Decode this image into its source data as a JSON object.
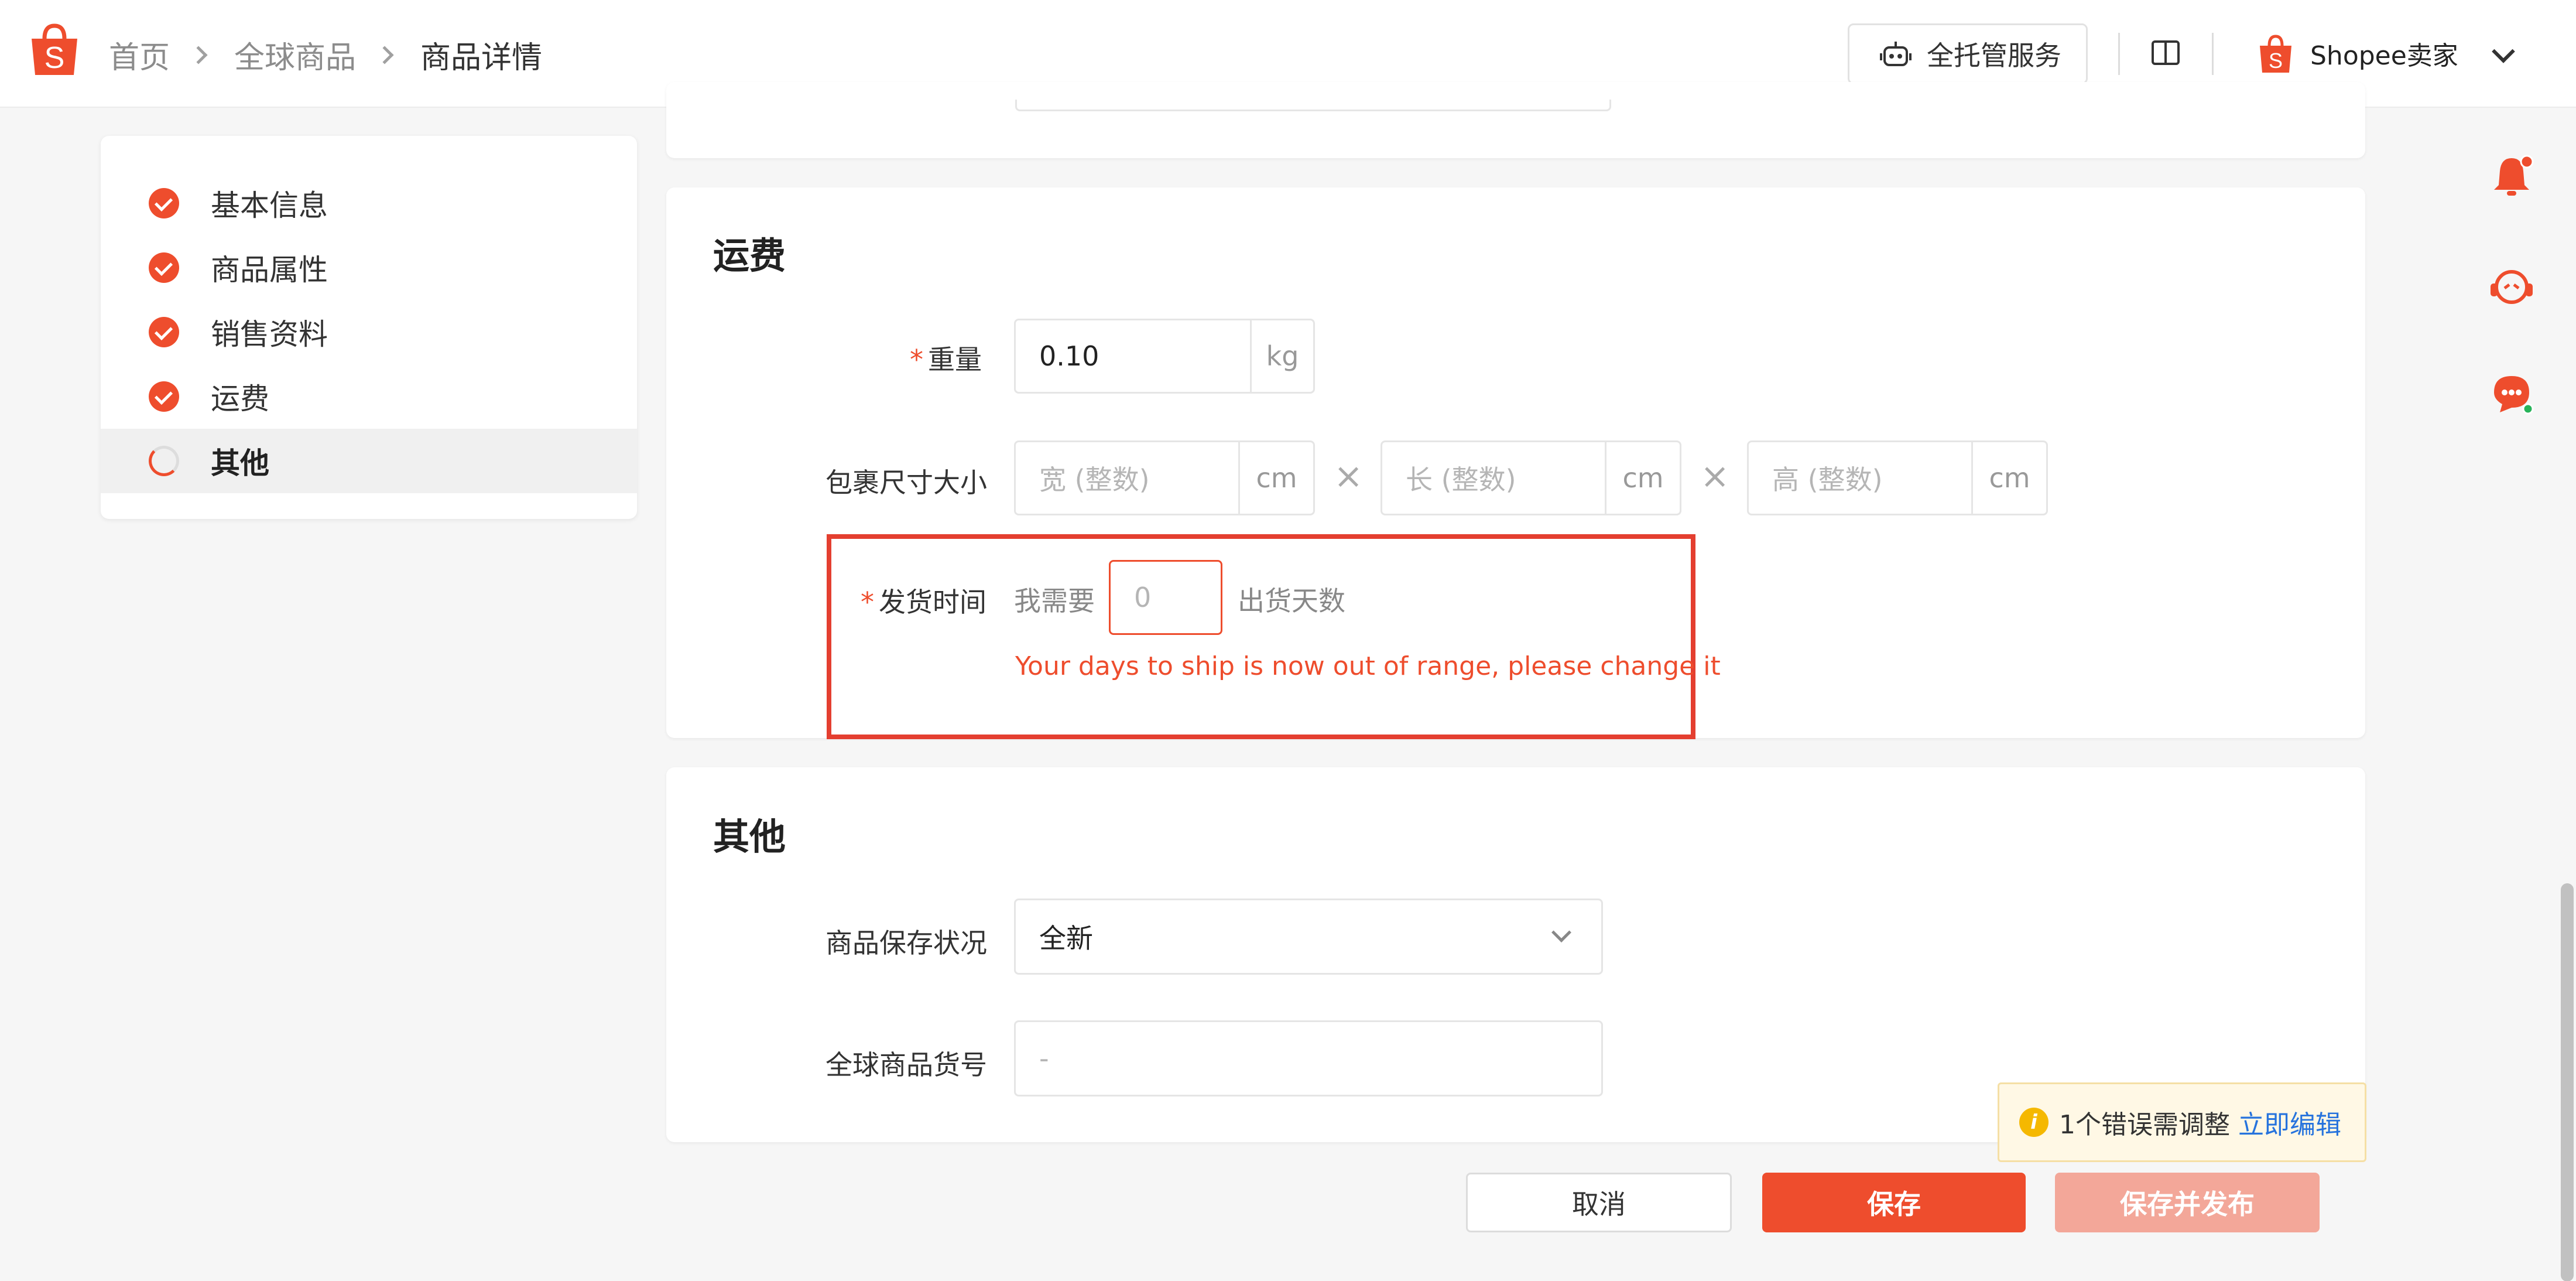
{
  "header": {
    "breadcrumb": [
      "首页",
      "全球商品",
      "商品详情"
    ],
    "service_button": "全托管服务",
    "seller_name": "Shopee卖家",
    "logo_letter": "S"
  },
  "nav": {
    "items": [
      {
        "label": "基本信息",
        "status": "done"
      },
      {
        "label": "商品属性",
        "status": "done"
      },
      {
        "label": "销售资料",
        "status": "done"
      },
      {
        "label": "运费",
        "status": "done"
      },
      {
        "label": "其他",
        "status": "current"
      }
    ]
  },
  "shipping": {
    "title": "运费",
    "weight": {
      "label": "重量",
      "required_mark": "*",
      "value": "0.10",
      "unit": "kg"
    },
    "package": {
      "label": "包裹尺寸大小",
      "times_symbol": "×",
      "width": {
        "placeholder": "宽 (整数)",
        "unit": "cm"
      },
      "length": {
        "placeholder": "长 (整数)",
        "unit": "cm"
      },
      "height": {
        "placeholder": "高 (整数)",
        "unit": "cm"
      }
    },
    "days_to_ship": {
      "label": "发货时间",
      "required_mark": "*",
      "prefix": "我需要",
      "placeholder": "0",
      "suffix": "出货天数",
      "error": "Your days to ship is now out of range, please change it"
    }
  },
  "other": {
    "title": "其他",
    "condition": {
      "label": "商品保存状况",
      "value": "全新"
    },
    "sku": {
      "label": "全球商品货号",
      "placeholder": "-"
    }
  },
  "notice": {
    "icon": "i",
    "text": "1个错误需调整",
    "link": "立即编辑"
  },
  "actions": {
    "cancel": "取消",
    "save": "保存",
    "save_publish": "保存并发布"
  },
  "colors": {
    "brand": "#ee4d2d",
    "error_border": "#e43f30",
    "link": "#2673dd"
  }
}
